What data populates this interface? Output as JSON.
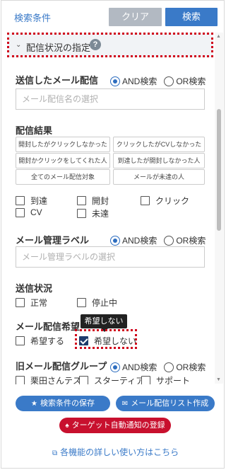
{
  "header": {
    "title": "検索条件",
    "clear_label": "クリア",
    "search_label": "検索"
  },
  "section": {
    "title": "配信状況の指定",
    "help": "?"
  },
  "sent_mail": {
    "label": "送信したメール配信",
    "and_label": "AND検索",
    "or_label": "OR検索",
    "placeholder": "メール配信名の選択"
  },
  "result": {
    "label": "配信結果",
    "pills": [
      "開封したがクリックしなかった人",
      "クリックしたがCVしなかった人",
      "開封かクリックをしてくれた人",
      "到達したが開封しなかった人",
      "全てのメール配信対象",
      "メールが未達の人"
    ],
    "checkboxes": [
      "到達",
      "開封",
      "クリック",
      "CV",
      "未達"
    ]
  },
  "label_mgmt": {
    "label": "メール管理ラベル",
    "and_label": "AND検索",
    "or_label": "OR検索",
    "placeholder": "メール管理ラベルの選択"
  },
  "status": {
    "label": "送信状況",
    "checkboxes": [
      "正常",
      "停止中"
    ]
  },
  "wish": {
    "label": "メール配信希望",
    "checkboxes": [
      "希望する",
      "希望しない"
    ],
    "tooltip": "希望しない"
  },
  "old_group": {
    "label": "旧メール配信グループ",
    "and_label": "AND検索",
    "or_label": "OR検索",
    "checkboxes": [
      "栗田さんテス",
      "スターティア",
      "サポート"
    ]
  },
  "footer": {
    "save_label": "検索条件の保存",
    "list_label": "メール配信リスト作成",
    "register_label": "ターゲット自動通知の登録",
    "help_link": "各機能の詳しい使い方はこちら"
  },
  "colors": {
    "accent": "#3a7ac8",
    "danger": "#c8102e",
    "highlight": "#d0021b"
  }
}
